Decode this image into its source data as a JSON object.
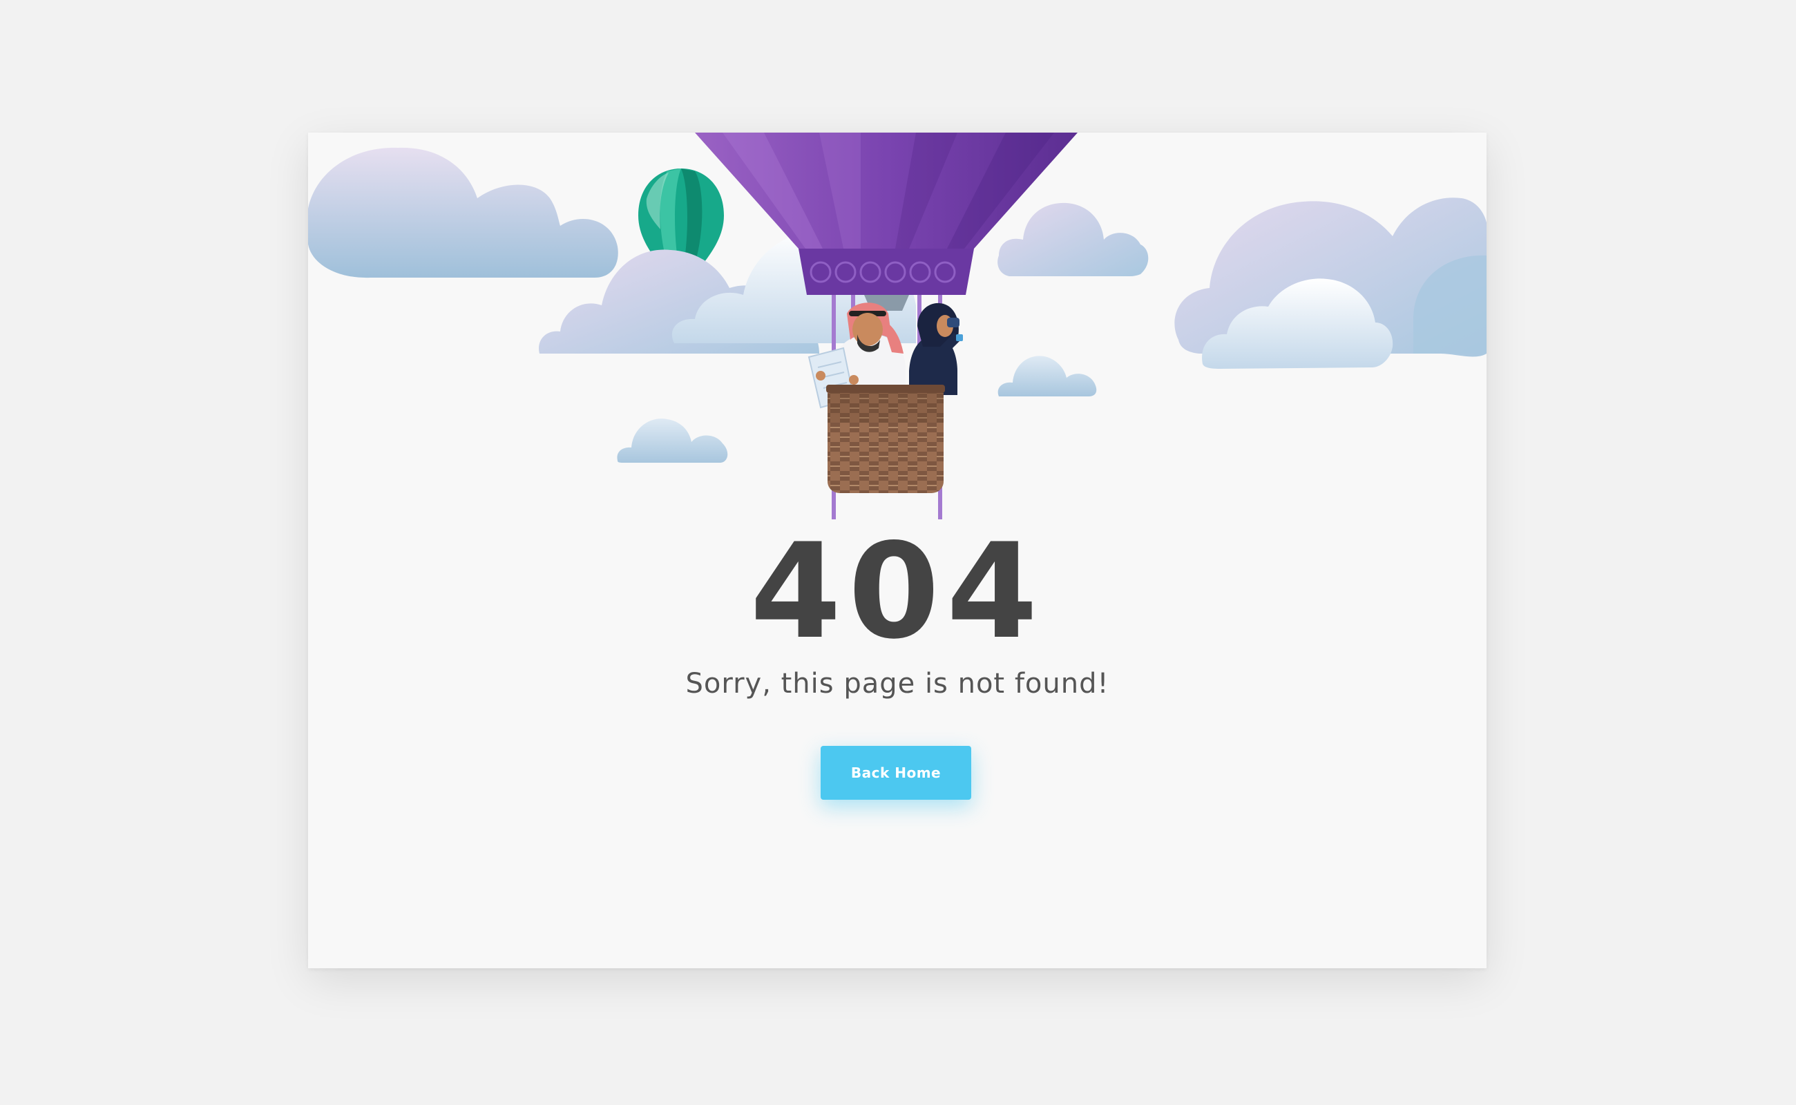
{
  "error": {
    "code": "404",
    "message": "Sorry, this page is not found!"
  },
  "actions": {
    "back_home_label": "Back Home"
  },
  "colors": {
    "page_background": "#f2f2f2",
    "card_background": "#f8f8f8",
    "accent_button": "#4cc8f0",
    "heading_text": "#444444",
    "balloon_purple": "#7a44b0",
    "small_balloon_green": "#17a98a"
  },
  "illustration": {
    "main": "hot-air-balloon-icon",
    "secondary": "small-balloon-icon",
    "decor": "cloud-icon"
  }
}
